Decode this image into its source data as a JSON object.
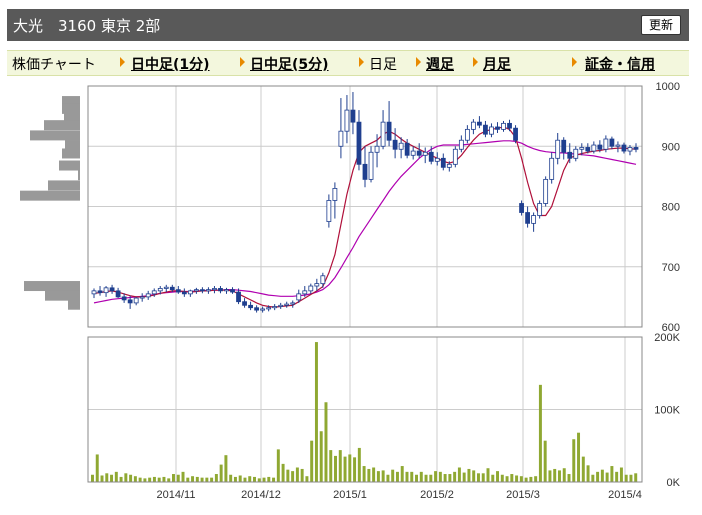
{
  "header": {
    "title": "大光　3160 東京 2部",
    "refresh_label": "更新"
  },
  "tabs": [
    {
      "label": "株価チャート",
      "link": false,
      "arrow": false
    },
    {
      "label": "日中足(1分)",
      "link": true,
      "arrow": true
    },
    {
      "label": "日中足(5分)",
      "link": true,
      "arrow": true
    },
    {
      "label": "日足",
      "link": false,
      "arrow": true
    },
    {
      "label": "週足",
      "link": true,
      "arrow": true
    },
    {
      "label": "月足",
      "link": true,
      "arrow": true
    },
    {
      "label": "証金・信用",
      "link": true,
      "arrow": true
    }
  ],
  "colors": {
    "up": "#ffffff",
    "down": "#1f3f8f",
    "ma_short": "#b0103a",
    "ma_long": "#b000b0",
    "volume": "#8fa832",
    "profile": "#999999"
  },
  "chart_data": [
    {
      "type": "candlestick",
      "x_tick_labels": [
        "2014/11",
        "2014/12",
        "2015/1",
        "2015/2",
        "2015/3",
        "2015/4"
      ],
      "y_tick_labels": [
        "1000",
        "900",
        "800",
        "700",
        "600"
      ],
      "ylim": [
        600,
        1000
      ],
      "candles": [
        {
          "o": 655,
          "h": 664,
          "l": 648,
          "c": 660
        },
        {
          "o": 660,
          "h": 668,
          "l": 652,
          "c": 657
        },
        {
          "o": 657,
          "h": 668,
          "l": 650,
          "c": 665
        },
        {
          "o": 665,
          "h": 670,
          "l": 655,
          "c": 660
        },
        {
          "o": 660,
          "h": 665,
          "l": 648,
          "c": 650
        },
        {
          "o": 650,
          "h": 656,
          "l": 640,
          "c": 645
        },
        {
          "o": 645,
          "h": 652,
          "l": 630,
          "c": 640
        },
        {
          "o": 640,
          "h": 650,
          "l": 636,
          "c": 648
        },
        {
          "o": 648,
          "h": 656,
          "l": 642,
          "c": 650
        },
        {
          "o": 650,
          "h": 660,
          "l": 645,
          "c": 655
        },
        {
          "o": 655,
          "h": 664,
          "l": 650,
          "c": 660
        },
        {
          "o": 660,
          "h": 668,
          "l": 654,
          "c": 664
        },
        {
          "o": 664,
          "h": 670,
          "l": 658,
          "c": 666
        },
        {
          "o": 666,
          "h": 670,
          "l": 658,
          "c": 662
        },
        {
          "o": 662,
          "h": 668,
          "l": 655,
          "c": 658
        },
        {
          "o": 658,
          "h": 664,
          "l": 650,
          "c": 655
        },
        {
          "o": 655,
          "h": 662,
          "l": 650,
          "c": 660
        },
        {
          "o": 660,
          "h": 665,
          "l": 655,
          "c": 662
        },
        {
          "o": 662,
          "h": 666,
          "l": 656,
          "c": 660
        },
        {
          "o": 660,
          "h": 666,
          "l": 655,
          "c": 662
        },
        {
          "o": 662,
          "h": 668,
          "l": 656,
          "c": 664
        },
        {
          "o": 664,
          "h": 668,
          "l": 656,
          "c": 660
        },
        {
          "o": 660,
          "h": 665,
          "l": 655,
          "c": 662
        },
        {
          "o": 662,
          "h": 666,
          "l": 655,
          "c": 658
        },
        {
          "o": 658,
          "h": 664,
          "l": 638,
          "c": 642
        },
        {
          "o": 642,
          "h": 648,
          "l": 632,
          "c": 636
        },
        {
          "o": 636,
          "h": 642,
          "l": 628,
          "c": 632
        },
        {
          "o": 632,
          "h": 636,
          "l": 624,
          "c": 628
        },
        {
          "o": 628,
          "h": 634,
          "l": 624,
          "c": 630
        },
        {
          "o": 630,
          "h": 636,
          "l": 626,
          "c": 632
        },
        {
          "o": 632,
          "h": 638,
          "l": 628,
          "c": 634
        },
        {
          "o": 634,
          "h": 640,
          "l": 630,
          "c": 636
        },
        {
          "o": 636,
          "h": 642,
          "l": 632,
          "c": 638
        },
        {
          "o": 638,
          "h": 644,
          "l": 632,
          "c": 640
        },
        {
          "o": 645,
          "h": 662,
          "l": 640,
          "c": 655
        },
        {
          "o": 655,
          "h": 668,
          "l": 650,
          "c": 660
        },
        {
          "o": 660,
          "h": 672,
          "l": 655,
          "c": 668
        },
        {
          "o": 668,
          "h": 680,
          "l": 660,
          "c": 672
        },
        {
          "o": 672,
          "h": 690,
          "l": 665,
          "c": 685
        },
        {
          "o": 775,
          "h": 820,
          "l": 765,
          "c": 810
        },
        {
          "o": 810,
          "h": 840,
          "l": 780,
          "c": 830
        },
        {
          "o": 900,
          "h": 980,
          "l": 880,
          "c": 925
        },
        {
          "o": 925,
          "h": 985,
          "l": 905,
          "c": 960
        },
        {
          "o": 960,
          "h": 990,
          "l": 920,
          "c": 940
        },
        {
          "o": 940,
          "h": 960,
          "l": 860,
          "c": 870
        },
        {
          "o": 870,
          "h": 900,
          "l": 832,
          "c": 845
        },
        {
          "o": 845,
          "h": 900,
          "l": 840,
          "c": 890
        },
        {
          "o": 890,
          "h": 920,
          "l": 865,
          "c": 900
        },
        {
          "o": 900,
          "h": 960,
          "l": 895,
          "c": 940
        },
        {
          "o": 940,
          "h": 975,
          "l": 900,
          "c": 910
        },
        {
          "o": 910,
          "h": 930,
          "l": 880,
          "c": 895
        },
        {
          "o": 895,
          "h": 915,
          "l": 880,
          "c": 905
        },
        {
          "o": 905,
          "h": 912,
          "l": 880,
          "c": 885
        },
        {
          "o": 885,
          "h": 900,
          "l": 878,
          "c": 892
        },
        {
          "o": 892,
          "h": 905,
          "l": 880,
          "c": 885
        },
        {
          "o": 885,
          "h": 898,
          "l": 872,
          "c": 890
        },
        {
          "o": 890,
          "h": 900,
          "l": 870,
          "c": 875
        },
        {
          "o": 875,
          "h": 890,
          "l": 868,
          "c": 880
        },
        {
          "o": 880,
          "h": 888,
          "l": 860,
          "c": 865
        },
        {
          "o": 865,
          "h": 875,
          "l": 858,
          "c": 870
        },
        {
          "o": 870,
          "h": 900,
          "l": 865,
          "c": 895
        },
        {
          "o": 895,
          "h": 918,
          "l": 890,
          "c": 910
        },
        {
          "o": 910,
          "h": 935,
          "l": 905,
          "c": 928
        },
        {
          "o": 928,
          "h": 945,
          "l": 920,
          "c": 940
        },
        {
          "o": 940,
          "h": 950,
          "l": 930,
          "c": 935
        },
        {
          "o": 935,
          "h": 942,
          "l": 915,
          "c": 920
        },
        {
          "o": 920,
          "h": 938,
          "l": 915,
          "c": 932
        },
        {
          "o": 932,
          "h": 940,
          "l": 922,
          "c": 928
        },
        {
          "o": 928,
          "h": 942,
          "l": 924,
          "c": 938
        },
        {
          "o": 938,
          "h": 944,
          "l": 925,
          "c": 930
        },
        {
          "o": 930,
          "h": 935,
          "l": 905,
          "c": 910
        },
        {
          "o": 805,
          "h": 810,
          "l": 785,
          "c": 790
        },
        {
          "o": 790,
          "h": 800,
          "l": 765,
          "c": 772
        },
        {
          "o": 772,
          "h": 790,
          "l": 758,
          "c": 785
        },
        {
          "o": 785,
          "h": 810,
          "l": 780,
          "c": 805
        },
        {
          "o": 805,
          "h": 850,
          "l": 800,
          "c": 845
        },
        {
          "o": 845,
          "h": 890,
          "l": 838,
          "c": 880
        },
        {
          "o": 880,
          "h": 922,
          "l": 870,
          "c": 910
        },
        {
          "o": 910,
          "h": 915,
          "l": 878,
          "c": 890
        },
        {
          "o": 890,
          "h": 905,
          "l": 872,
          "c": 880
        },
        {
          "o": 880,
          "h": 900,
          "l": 875,
          "c": 895
        },
        {
          "o": 895,
          "h": 905,
          "l": 885,
          "c": 898
        },
        {
          "o": 898,
          "h": 905,
          "l": 888,
          "c": 892
        },
        {
          "o": 892,
          "h": 908,
          "l": 888,
          "c": 902
        },
        {
          "o": 902,
          "h": 910,
          "l": 890,
          "c": 895
        },
        {
          "o": 895,
          "h": 918,
          "l": 890,
          "c": 912
        },
        {
          "o": 912,
          "h": 916,
          "l": 895,
          "c": 900
        },
        {
          "o": 900,
          "h": 908,
          "l": 890,
          "c": 902
        },
        {
          "o": 902,
          "h": 906,
          "l": 888,
          "c": 892
        },
        {
          "o": 892,
          "h": 902,
          "l": 885,
          "c": 898
        },
        {
          "o": 898,
          "h": 905,
          "l": 890,
          "c": 895
        }
      ],
      "ma_short": [
        656,
        657,
        659,
        660,
        658,
        655,
        652,
        650,
        650,
        651,
        653,
        656,
        658,
        660,
        660,
        659,
        658,
        659,
        660,
        660,
        661,
        661,
        661,
        660,
        655,
        650,
        645,
        640,
        636,
        634,
        633,
        634,
        635,
        636,
        642,
        648,
        654,
        660,
        667,
        690,
        720,
        770,
        820,
        860,
        890,
        900,
        905,
        910,
        920,
        925,
        920,
        912,
        905,
        900,
        895,
        890,
        885,
        880,
        875,
        872,
        875,
        885,
        898,
        910,
        920,
        925,
        928,
        930,
        932,
        928,
        915,
        880,
        840,
        805,
        785,
        785,
        800,
        830,
        860,
        880,
        885,
        888,
        890,
        892,
        893,
        895,
        896,
        897,
        897,
        896,
        895
      ],
      "ma_long": [
        640,
        642,
        644,
        646,
        647,
        648,
        649,
        650,
        651,
        652,
        654,
        656,
        657,
        658,
        659,
        659,
        659,
        660,
        660,
        661,
        661,
        661,
        662,
        662,
        661,
        660,
        659,
        657,
        655,
        653,
        652,
        651,
        651,
        651,
        652,
        653,
        655,
        658,
        662,
        670,
        682,
        698,
        715,
        732,
        750,
        765,
        780,
        795,
        810,
        825,
        838,
        850,
        860,
        870,
        880,
        888,
        895,
        900,
        902,
        902,
        902,
        902,
        903,
        904,
        905,
        906,
        907,
        908,
        909,
        909,
        908,
        905,
        900,
        896,
        893,
        891,
        890,
        889,
        889,
        888,
        887,
        886,
        885,
        884,
        882,
        880,
        878,
        876,
        874,
        872,
        870
      ]
    },
    {
      "type": "bar",
      "title": "volume",
      "y_tick_labels": [
        "200K",
        "100K",
        "0K"
      ],
      "ylim": [
        0,
        200000
      ],
      "values": [
        10000,
        38000,
        9000,
        12000,
        10000,
        14000,
        7000,
        12000,
        10000,
        8000,
        6000,
        5000,
        6000,
        7000,
        6000,
        7000,
        5000,
        11000,
        10000,
        14000,
        6000,
        8000,
        7000,
        6000,
        6000,
        6000,
        11000,
        24000,
        37000,
        10000,
        7000,
        9000,
        6000,
        8000,
        7000,
        5000,
        6000,
        7000,
        6000,
        45000,
        25000,
        17000,
        15000,
        20000,
        18000,
        8000,
        57000,
        193000,
        70000,
        110000,
        44000,
        36000,
        44000,
        35000,
        38000,
        34000,
        47000,
        22000,
        18000,
        20000,
        15000,
        16000,
        10000,
        17000,
        14000,
        22000,
        14000,
        14000,
        10000,
        14000,
        10000,
        10000,
        15000,
        14000,
        11000,
        11000,
        14000,
        20000,
        13000,
        18000,
        16000,
        12000,
        12000,
        19000,
        10000,
        15000,
        10000,
        8000,
        11000,
        9000,
        8000,
        6000,
        7000,
        8000,
        134000,
        57000,
        16000,
        18000,
        16000,
        19000,
        11000,
        59000,
        68000,
        35000,
        23000,
        10000,
        14000,
        17000,
        13000,
        22000,
        14000,
        20000,
        10000,
        10000,
        12000
      ]
    },
    {
      "type": "bar",
      "title": "price-band volume",
      "orientation": "horizontal",
      "bands": [
        {
          "price": 975,
          "value": 18
        },
        {
          "price": 962,
          "value": 18
        },
        {
          "price": 948,
          "value": 16
        },
        {
          "price": 935,
          "value": 36
        },
        {
          "price": 918,
          "value": 50
        },
        {
          "price": 902,
          "value": 15
        },
        {
          "price": 888,
          "value": 18
        },
        {
          "price": 868,
          "value": 21
        },
        {
          "price": 852,
          "value": 2
        },
        {
          "price": 835,
          "value": 32
        },
        {
          "price": 818,
          "value": 60
        },
        {
          "price": 668,
          "value": 56
        },
        {
          "price": 652,
          "value": 35
        },
        {
          "price": 637,
          "value": 12
        }
      ]
    }
  ]
}
